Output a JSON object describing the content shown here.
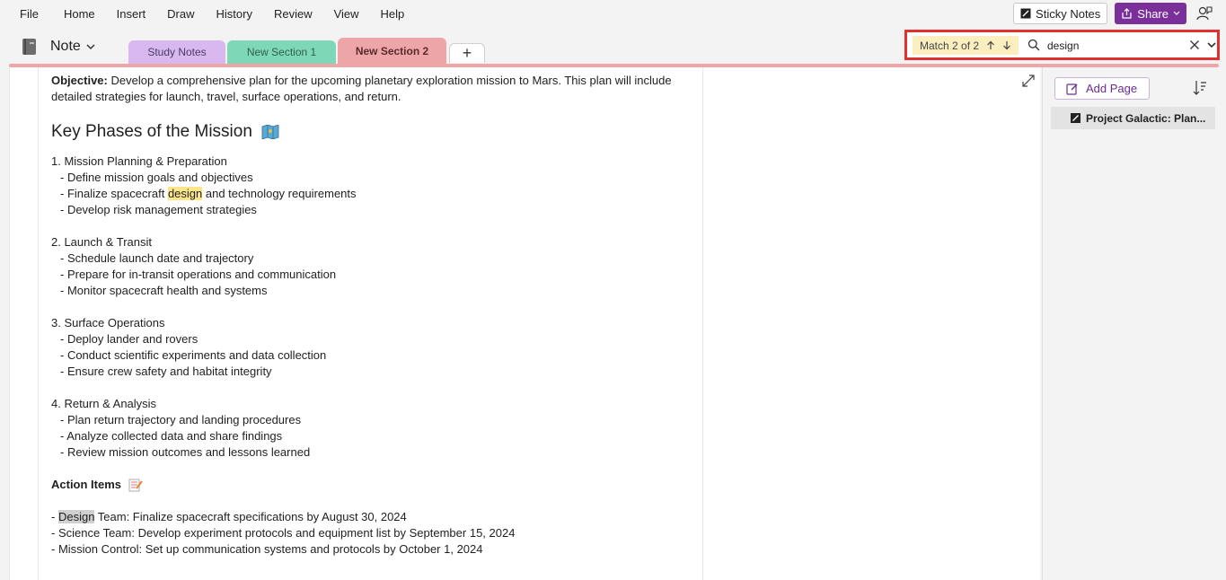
{
  "menu": {
    "items": [
      "File",
      "Home",
      "Insert",
      "Draw",
      "History",
      "Review",
      "View",
      "Help"
    ],
    "sticky_notes_label": "Sticky Notes",
    "share_label": "Share"
  },
  "notebook": {
    "name": "Note",
    "tabs": [
      {
        "label": "Study Notes",
        "color": "#d8b8ef"
      },
      {
        "label": "New Section 1",
        "color": "#7ed8b8"
      },
      {
        "label": "New Section 2",
        "color": "#eea5a8",
        "active": true
      }
    ],
    "add_tab_label": "+"
  },
  "search": {
    "match_label": "Match 2 of 2",
    "query": "design"
  },
  "note": {
    "objective_label": "Objective:",
    "objective_text": " Develop a comprehensive plan for the upcoming planetary exploration mission to Mars. This plan will include detailed strategies for launch, travel, surface operations, and return.",
    "phases_heading": "Key Phases of the Mission",
    "phases": [
      {
        "title": "1. Mission Planning & Preparation",
        "items": [
          {
            "text": "- Define mission goals and objectives"
          },
          {
            "pre": "- Finalize spacecraft ",
            "hl": "design",
            "post": " and technology requirements"
          },
          {
            "text": "- Develop risk management strategies"
          }
        ]
      },
      {
        "title": "2. Launch & Transit",
        "items": [
          {
            "text": "- Schedule launch date and trajectory"
          },
          {
            "text": "- Prepare for in-transit operations and communication"
          },
          {
            "text": "- Monitor spacecraft health and systems"
          }
        ]
      },
      {
        "title": "3. Surface Operations",
        "items": [
          {
            "text": "- Deploy lander and rovers"
          },
          {
            "text": "- Conduct scientific experiments and data collection"
          },
          {
            "text": "- Ensure crew safety and habitat integrity"
          }
        ]
      },
      {
        "title": "4. Return & Analysis",
        "items": [
          {
            "text": "- Plan return trajectory and landing procedures"
          },
          {
            "text": "- Analyze collected data and share findings"
          },
          {
            "text": "- Review mission outcomes and lessons learned"
          }
        ]
      }
    ],
    "action_heading": "Action Items",
    "actions": [
      {
        "pre": "- ",
        "hl": "Design",
        "post": " Team: Finalize spacecraft specifications by August 30, 2024"
      },
      {
        "text": "- Science Team: Develop experiment protocols and equipment list by September 15, 2024"
      },
      {
        "text": "- Mission Control: Set up communication systems and protocols by October 1, 2024"
      }
    ]
  },
  "pages_pane": {
    "add_page_label": "Add Page",
    "pages": [
      "Project Galactic: Plan..."
    ]
  },
  "colors": {
    "accent": "#7a2f9a",
    "section_active": "#eea5a8",
    "search_highlight": "#fde68a",
    "match_highlight": "#d0d0d0"
  }
}
